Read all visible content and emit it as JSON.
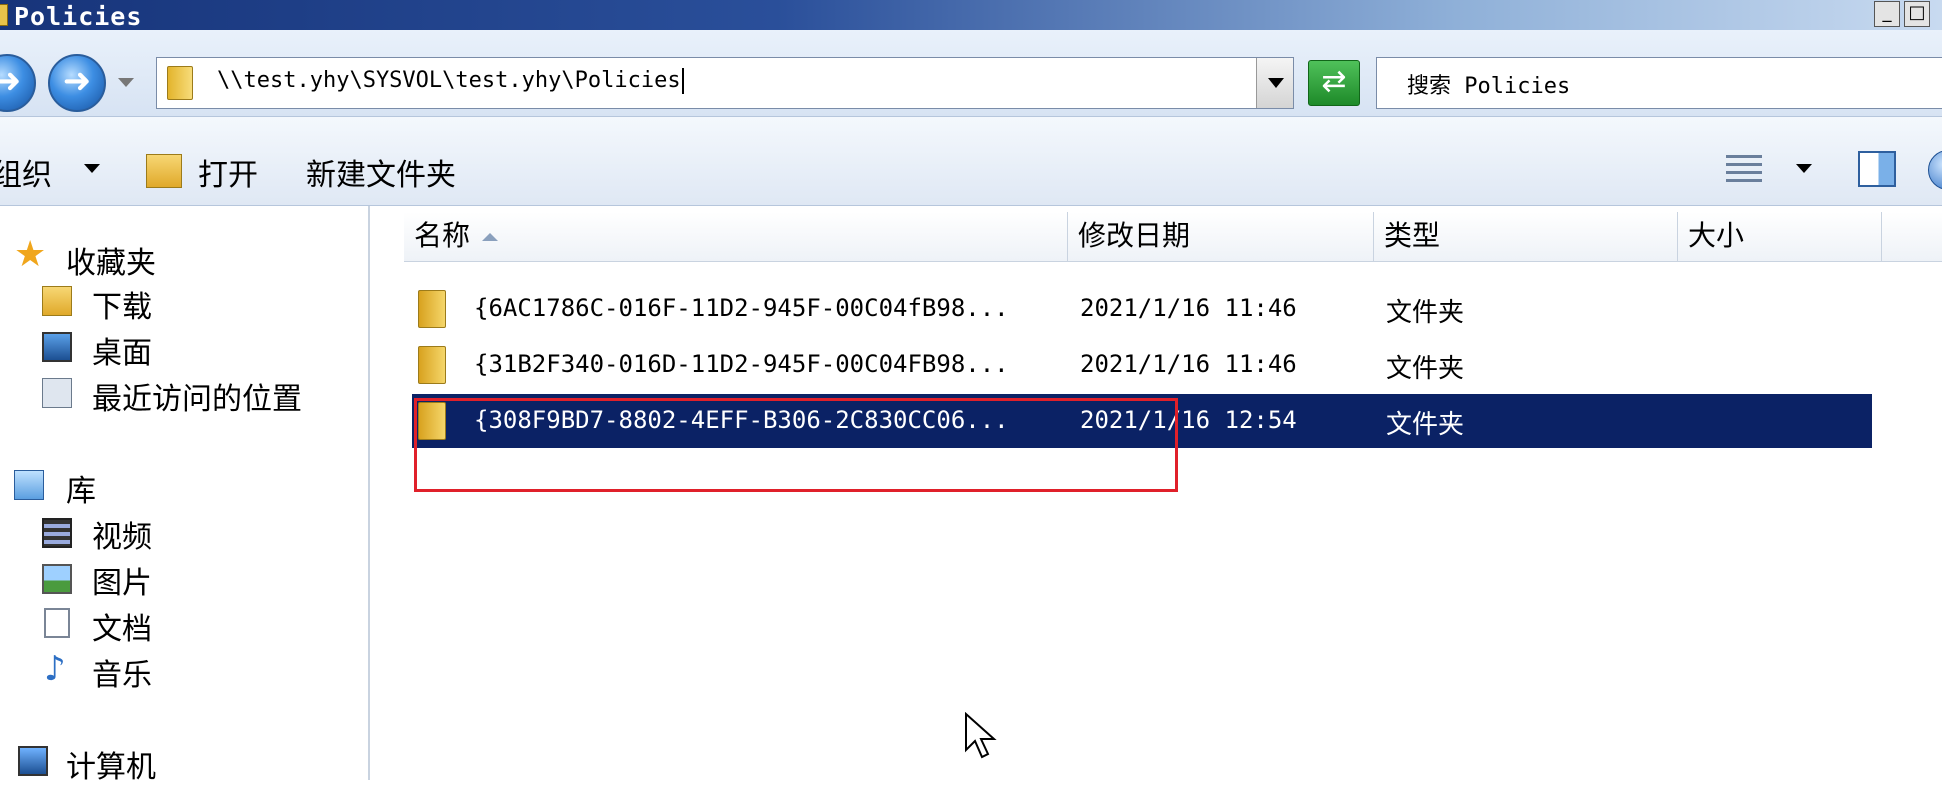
{
  "window": {
    "title": "Policies",
    "minimize_label": "_",
    "restore_label": "□"
  },
  "address_bar": {
    "path": "\\\\test.yhy\\SYSVOL\\test.yhy\\Policies"
  },
  "search": {
    "placeholder": "搜索 Policies"
  },
  "toolbar": {
    "organize_label": "组织",
    "open_label": "打开",
    "new_folder_label": "新建文件夹"
  },
  "nav": {
    "favorites": {
      "label": "收藏夹",
      "icon": "star-icon",
      "items": [
        {
          "label": "下载",
          "icon": "downloads-folder-icon"
        },
        {
          "label": "桌面",
          "icon": "desktop-icon"
        },
        {
          "label": "最近访问的位置",
          "icon": "recent-places-icon"
        }
      ]
    },
    "libraries": {
      "label": "库",
      "icon": "library-icon",
      "items": [
        {
          "label": "视频",
          "icon": "video-icon"
        },
        {
          "label": "图片",
          "icon": "pictures-icon"
        },
        {
          "label": "文档",
          "icon": "documents-icon"
        },
        {
          "label": "音乐",
          "icon": "music-icon"
        }
      ]
    },
    "computer": {
      "label": "计算机",
      "icon": "computer-icon"
    }
  },
  "columns": {
    "name": "名称",
    "modified": "修改日期",
    "type": "类型",
    "size": "大小"
  },
  "files": [
    {
      "name": "{6AC1786C-016F-11D2-945F-00C04fB98...",
      "modified": "2021/1/16 11:46",
      "type": "文件夹",
      "selected": false
    },
    {
      "name": "{31B2F340-016D-11D2-945F-00C04FB98...",
      "modified": "2021/1/16 11:46",
      "type": "文件夹",
      "selected": false
    },
    {
      "name": "{308F9BD7-8802-4EFF-B306-2C830CC06...",
      "modified": "2021/1/16 12:54",
      "type": "文件夹",
      "selected": true
    }
  ],
  "colors": {
    "selection": "#0b2265",
    "highlight_box": "#e0202a",
    "title_bar": "#17347a"
  }
}
